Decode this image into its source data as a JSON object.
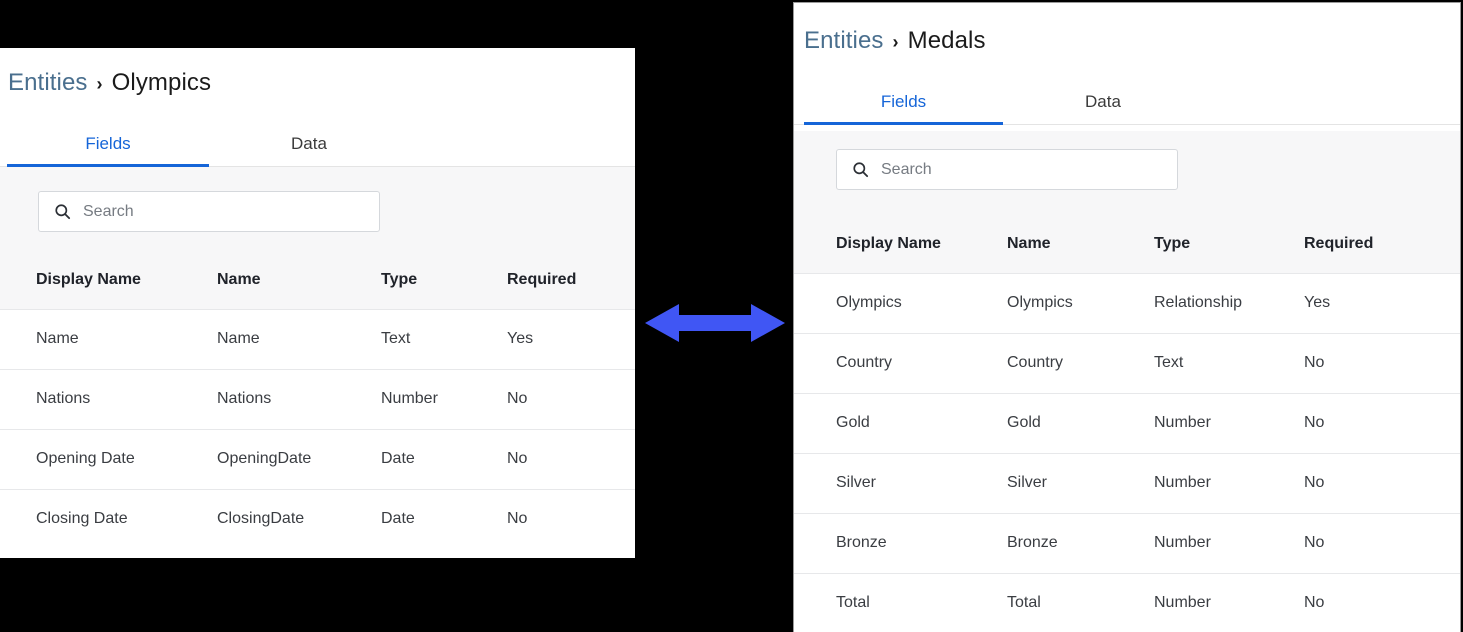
{
  "theme": {
    "accent": "#1565d8",
    "link": "#4a6f8e",
    "arrow": "#4056f4",
    "backdrop": "#000000",
    "strip_bg": "#f7f7f8",
    "border": "#e7e8ea"
  },
  "arrow": {
    "name": "double-headed-horizontal-arrow",
    "color": "#4056f4"
  },
  "left_panel": {
    "breadcrumb": {
      "root": "Entities",
      "separator": "›",
      "current": "Olympics"
    },
    "tabs": [
      {
        "label": "Fields",
        "active": true
      },
      {
        "label": "Data",
        "active": false
      }
    ],
    "search": {
      "placeholder": "Search",
      "value": "",
      "icon": "search-icon"
    },
    "table": {
      "columns": [
        "Display Name",
        "Name",
        "Type",
        "Required"
      ],
      "rows": [
        {
          "display_name": "Name",
          "name": "Name",
          "type": "Text",
          "required": "Yes"
        },
        {
          "display_name": "Nations",
          "name": "Nations",
          "type": "Number",
          "required": "No"
        },
        {
          "display_name": "Opening Date",
          "name": "OpeningDate",
          "type": "Date",
          "required": "No"
        },
        {
          "display_name": "Closing Date",
          "name": "ClosingDate",
          "type": "Date",
          "required": "No"
        }
      ]
    }
  },
  "right_panel": {
    "breadcrumb": {
      "root": "Entities",
      "separator": "›",
      "current": "Medals"
    },
    "tabs": [
      {
        "label": "Fields",
        "active": true
      },
      {
        "label": "Data",
        "active": false
      }
    ],
    "search": {
      "placeholder": "Search",
      "value": "",
      "icon": "search-icon"
    },
    "table": {
      "columns": [
        "Display Name",
        "Name",
        "Type",
        "Required"
      ],
      "rows": [
        {
          "display_name": "Olympics",
          "name": "Olympics",
          "type": "Relationship",
          "required": "Yes"
        },
        {
          "display_name": "Country",
          "name": "Country",
          "type": "Text",
          "required": "No"
        },
        {
          "display_name": "Gold",
          "name": "Gold",
          "type": "Number",
          "required": "No"
        },
        {
          "display_name": "Silver",
          "name": "Silver",
          "type": "Number",
          "required": "No"
        },
        {
          "display_name": "Bronze",
          "name": "Bronze",
          "type": "Number",
          "required": "No"
        },
        {
          "display_name": "Total",
          "name": "Total",
          "type": "Number",
          "required": "No"
        }
      ]
    }
  }
}
